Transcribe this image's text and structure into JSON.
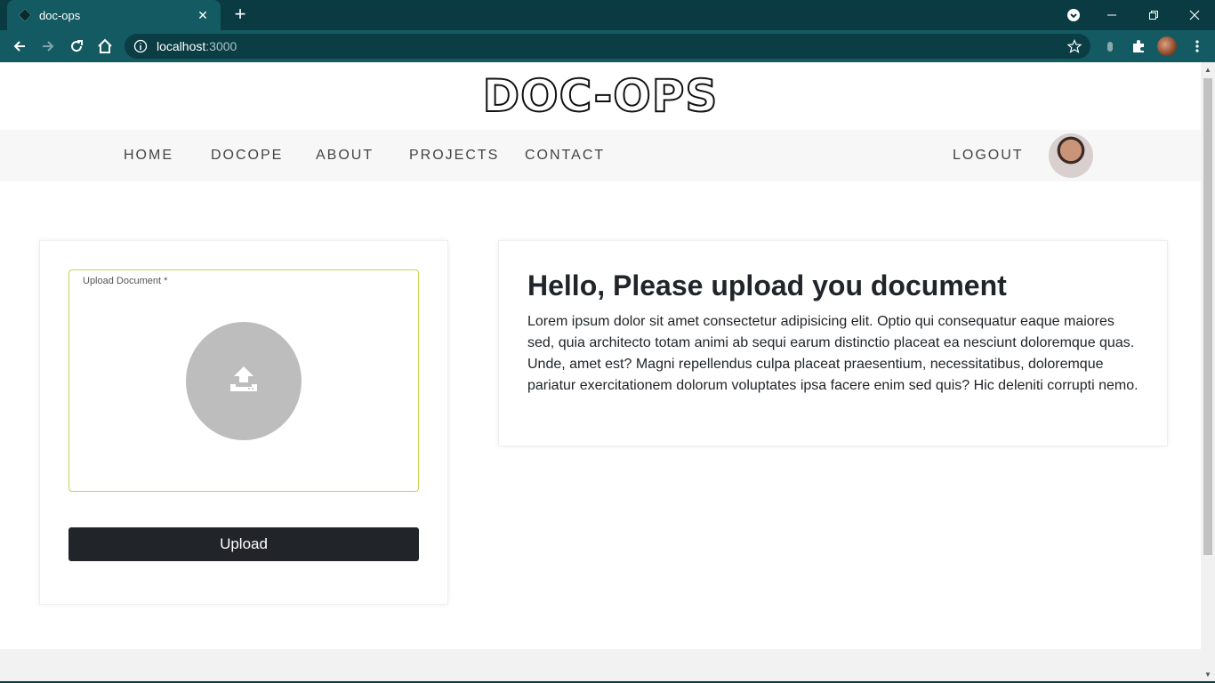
{
  "browser": {
    "tab_title": "doc-ops",
    "url_host": "localhost",
    "url_port": ":3000"
  },
  "site": {
    "logo_text": "DOC-OPS",
    "nav": {
      "items": [
        "HOME",
        "DOCOPE",
        "ABOUT",
        "PROJECTS",
        "CONTACT"
      ],
      "logout": "LOGOUT"
    }
  },
  "upload": {
    "field_label": "Upload Document *",
    "button_label": "Upload"
  },
  "intro": {
    "title": "Hello, Please upload you document",
    "body": "Lorem ipsum dolor sit amet consectetur adipisicing elit. Optio qui consequatur eaque maiores sed, quia architecto totam animi ab sequi earum distinctio placeat ea nesciunt doloremque quas. Unde, amet est? Magni repellendus culpa placeat praesentium, necessitatibus, doloremque pariatur exercitationem dolorum voluptates ipsa facere enim sed quis? Hic deleniti corrupti nemo."
  },
  "colors": {
    "browser_dark": "#0a3b43",
    "browser_tab": "#145a62",
    "dropzone_border": "#c7d356",
    "button_bg": "#212529",
    "upload_circle": "#bdbdbd"
  }
}
